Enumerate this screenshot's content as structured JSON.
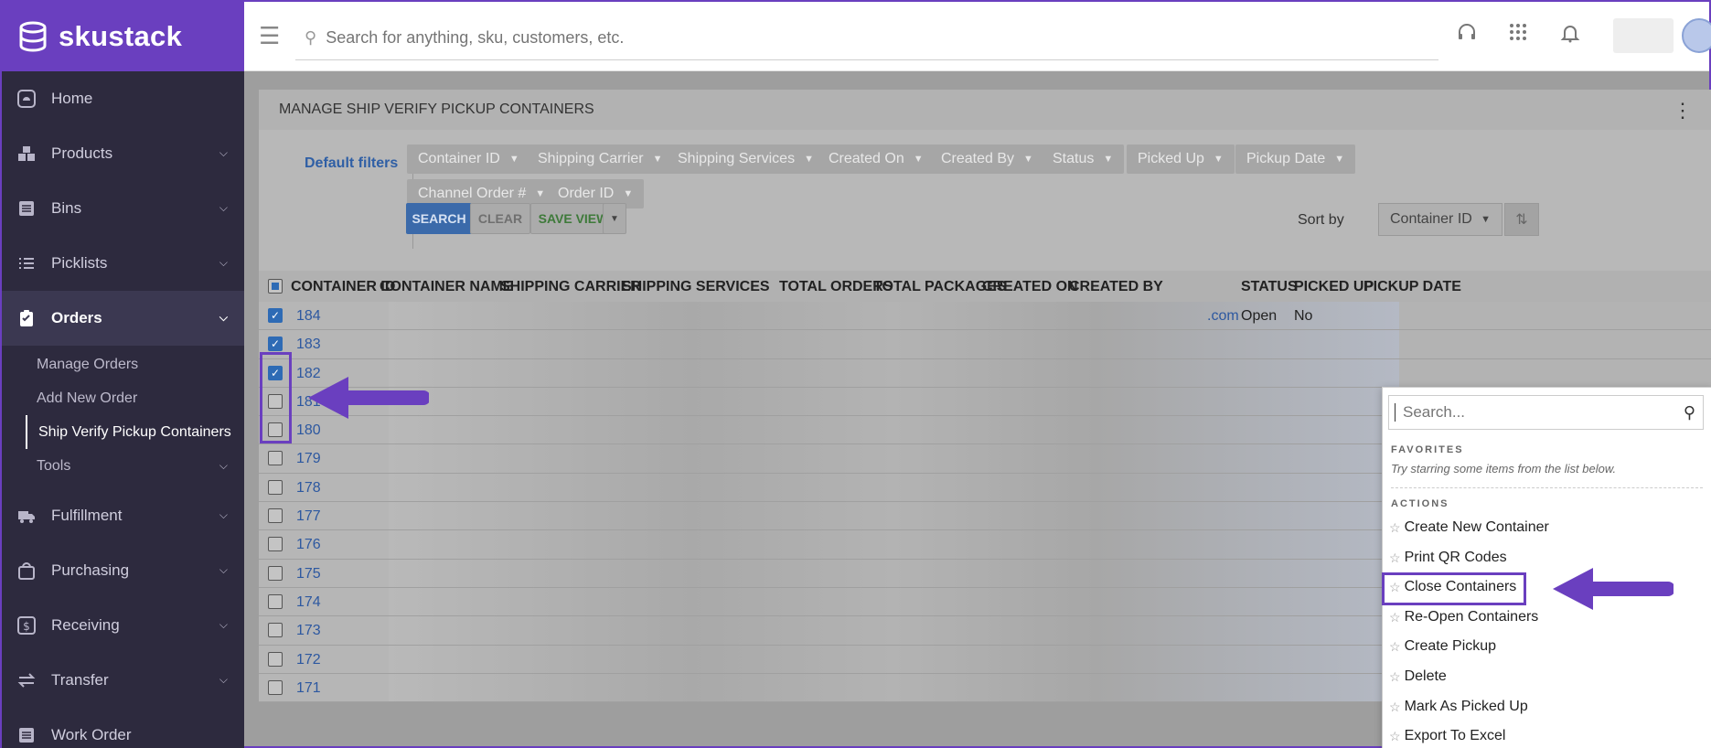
{
  "app": {
    "brand": "skustack"
  },
  "topbar": {
    "search_placeholder": "Search for anything, sku, customers, etc."
  },
  "sidebar": {
    "items": [
      {
        "label": "Home",
        "icon": "home-icon"
      },
      {
        "label": "Products",
        "icon": "boxes-icon"
      },
      {
        "label": "Bins",
        "icon": "list-box-icon"
      },
      {
        "label": "Picklists",
        "icon": "list-icon"
      },
      {
        "label": "Orders",
        "icon": "clipboard-icon"
      },
      {
        "label": "Fulfillment",
        "icon": "truck-icon"
      },
      {
        "label": "Purchasing",
        "icon": "bag-icon"
      },
      {
        "label": "Receiving",
        "icon": "dollar-icon"
      },
      {
        "label": "Transfer",
        "icon": "transfer-icon"
      },
      {
        "label": "Work Order",
        "icon": "work-order-icon"
      }
    ],
    "orders_sub": [
      {
        "label": "Manage Orders"
      },
      {
        "label": "Add New Order"
      },
      {
        "label": "Ship Verify Pickup Containers"
      },
      {
        "label": "Tools"
      }
    ]
  },
  "panel": {
    "title": "MANAGE SHIP VERIFY PICKUP CONTAINERS",
    "default_filters": "Default filters",
    "filters": [
      "Container ID",
      "Shipping Carrier",
      "Shipping Services",
      "Created On",
      "Created By",
      "Status",
      "Picked Up",
      "Pickup Date",
      "Channel Order #",
      "Order ID"
    ],
    "search_btn": "SEARCH",
    "clear_btn": "CLEAR",
    "save_view_btn": "SAVE VIEW",
    "sort_by_label": "Sort by",
    "sort_by_value": "Container ID"
  },
  "table": {
    "columns": [
      "CONTAINER ID",
      "CONTAINER NAME",
      "SHIPPING CARRIER",
      "SHIPPING SERVICES",
      "TOTAL ORDERS",
      "TOTAL PACKAGES",
      "CREATED ON",
      "CREATED BY",
      "STATUS",
      "PICKED UP",
      "PICKUP DATE"
    ],
    "rows": [
      {
        "id": "184",
        "checked": true,
        "email": ".com",
        "status": "Open",
        "picked": "No"
      },
      {
        "id": "183",
        "checked": true
      },
      {
        "id": "182",
        "checked": true
      },
      {
        "id": "181",
        "checked": false
      },
      {
        "id": "180",
        "checked": false
      },
      {
        "id": "179",
        "checked": false
      },
      {
        "id": "178",
        "checked": false
      },
      {
        "id": "177",
        "checked": false
      },
      {
        "id": "176",
        "checked": false
      },
      {
        "id": "175",
        "checked": false
      },
      {
        "id": "174",
        "checked": false
      },
      {
        "id": "173",
        "checked": false
      },
      {
        "id": "172",
        "checked": false
      },
      {
        "id": "171",
        "checked": false
      }
    ]
  },
  "dropdown": {
    "search_placeholder": "Search...",
    "favorites_label": "FAVORITES",
    "favorites_hint": "Try starring some items from the list below.",
    "actions_label": "ACTIONS",
    "actions": [
      "Create New Container",
      "Print QR Codes",
      "Close Containers",
      "Re-Open Containers",
      "Create Pickup",
      "Delete",
      "Mark As Picked Up",
      "Export To Excel"
    ]
  },
  "colors": {
    "accent": "#6a3fbf",
    "sidebar_bg": "#2d2a3e",
    "link": "#2d58a0"
  }
}
